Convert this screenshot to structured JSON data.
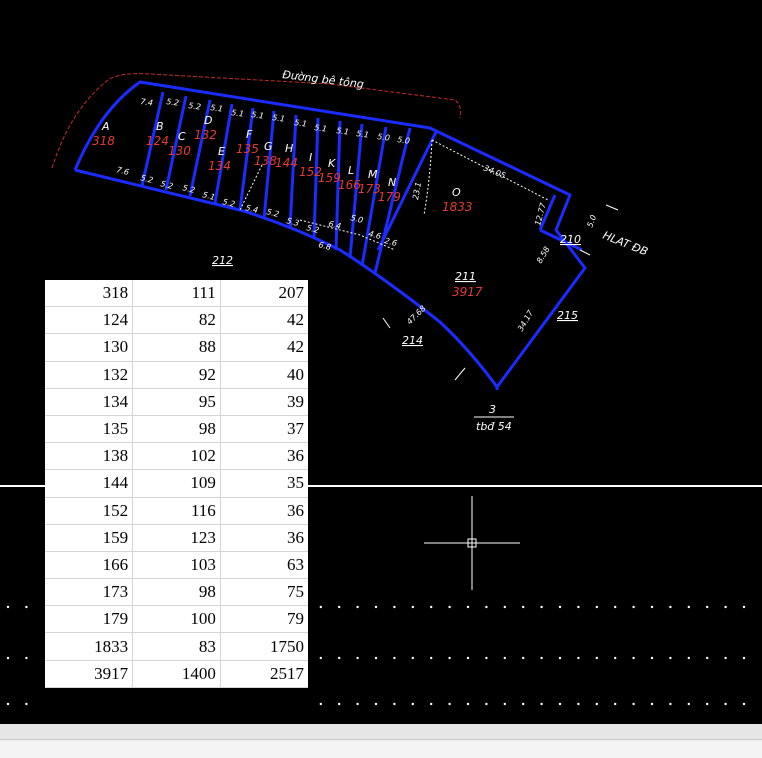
{
  "drawing": {
    "road_label": "Đường bê tông",
    "lots": [
      {
        "id": "A",
        "area": "318"
      },
      {
        "id": "B",
        "area": "124"
      },
      {
        "id": "C",
        "area": "130"
      },
      {
        "id": "D",
        "area": "132"
      },
      {
        "id": "E",
        "area": "134"
      },
      {
        "id": "F",
        "area": "135"
      },
      {
        "id": "G",
        "area": "138"
      },
      {
        "id": "H",
        "area": "144"
      },
      {
        "id": "I",
        "area": "152"
      },
      {
        "id": "K",
        "area": "159"
      },
      {
        "id": "L",
        "area": "166"
      },
      {
        "id": "M",
        "area": "173"
      },
      {
        "id": "N",
        "area": "179"
      },
      {
        "id": "O",
        "area": "1833"
      }
    ],
    "top_dims": [
      "7.4",
      "5.2",
      "5.2",
      "5.1",
      "5.1",
      "5.1",
      "5.1",
      "5.1",
      "5.1",
      "5.1",
      "5.1",
      "5.0",
      "5.0"
    ],
    "bottom_dims": [
      "7.6",
      "5.2",
      "5.2",
      "5.2",
      "5.1",
      "5.2",
      "5.4",
      "5.2",
      "5.3",
      "5.2",
      "6.8",
      "6.4",
      "5.0",
      "4.6",
      "2.6"
    ],
    "other_dims": {
      "d1": "34.05",
      "d2": "12.77",
      "d3": "5.0",
      "d4": "23.1",
      "d5": "47.68",
      "d6": "34.17",
      "d7": "8.58"
    },
    "parcel_212": "212",
    "parcel_211": "211",
    "parcel_211_area": "3917",
    "parcel_210": "210",
    "parcel_215": "215",
    "parcel_214": "214",
    "hlat": "HLAT ĐB",
    "sheet_num": "3",
    "sheet_label": "tbđ 54"
  },
  "area_table": [
    [
      "318",
      "111",
      "207"
    ],
    [
      "124",
      "82",
      "42"
    ],
    [
      "130",
      "88",
      "42"
    ],
    [
      "132",
      "92",
      "40"
    ],
    [
      "134",
      "95",
      "39"
    ],
    [
      "135",
      "98",
      "37"
    ],
    [
      "138",
      "102",
      "36"
    ],
    [
      "144",
      "109",
      "35"
    ],
    [
      "152",
      "116",
      "36"
    ],
    [
      "159",
      "123",
      "36"
    ],
    [
      "166",
      "103",
      "63"
    ],
    [
      "173",
      "98",
      "75"
    ],
    [
      "179",
      "100",
      "79"
    ],
    [
      "1833",
      "83",
      "1750"
    ],
    [
      "3917",
      "1400",
      "2517"
    ]
  ],
  "colors": {
    "background": "#000000",
    "boundary": "#1a2cff",
    "area_text": "#e53935",
    "road_line": "#c62828",
    "grid_dot": "#ffffff"
  }
}
